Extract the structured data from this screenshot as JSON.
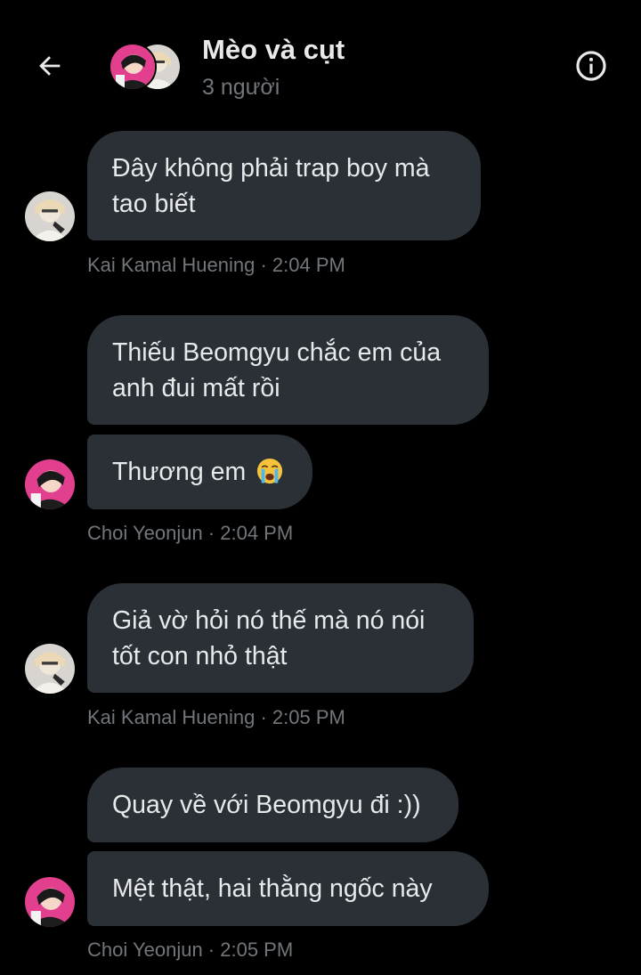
{
  "header": {
    "title": "Mèo và cụt",
    "subtitle": "3 người"
  },
  "messages": [
    {
      "lines": [
        "Đây không phải trap boy mà",
        "tao biết"
      ],
      "sender": "Kai Kamal Huening",
      "time": "2:04 PM"
    },
    {
      "lines": [
        "Thiếu Beomgyu chắc em của",
        "anh đui mất rồi"
      ]
    },
    {
      "text": "Thương em",
      "emoji": "loudly-crying-face",
      "sender": "Choi Yeonjun",
      "time": "2:04 PM"
    },
    {
      "lines": [
        "Giả vờ hỏi nó thế mà nó nói",
        "tốt con nhỏ thật"
      ],
      "sender": "Kai Kamal Huening",
      "time": "2:05 PM"
    },
    {
      "text": "Quay về với Beomgyu đi :))"
    },
    {
      "text": "Mệt thật, hai thằng ngốc này",
      "sender": "Choi Yeonjun",
      "time": "2:05 PM"
    }
  ],
  "meta_separator": " · ",
  "colors": {
    "background": "#000000",
    "bubble": "#2b3036",
    "text": "#e7e9ea",
    "muted": "#71767b"
  },
  "icons": {
    "back": "arrow-left-icon",
    "info": "info-circle-icon"
  }
}
